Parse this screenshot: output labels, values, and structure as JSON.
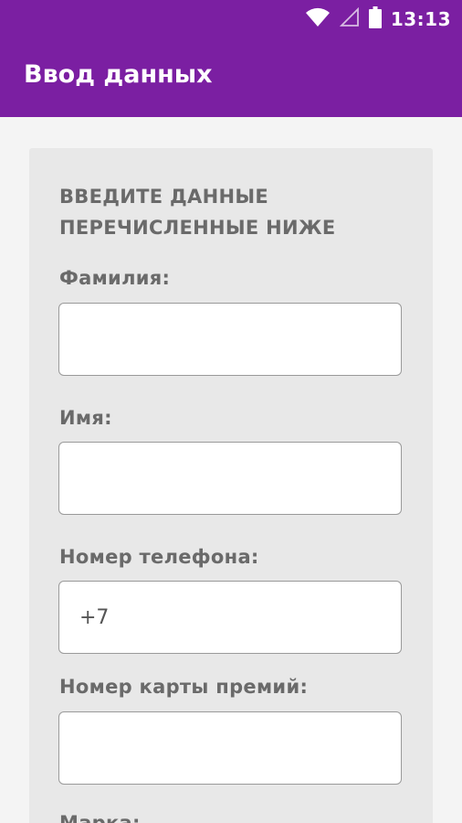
{
  "status_bar": {
    "time": "13:13",
    "icons": [
      "wifi-icon",
      "signal-icon",
      "battery-icon"
    ]
  },
  "app_bar": {
    "title": "Ввод данных",
    "color": "#7b1fa2"
  },
  "form": {
    "heading": "ВВЕДИТЕ ДАННЫЕ ПЕРЕЧИСЛЕННЫЕ НИЖЕ",
    "fields": [
      {
        "label": "Фамилия:",
        "value": ""
      },
      {
        "label": "Имя:",
        "value": ""
      },
      {
        "label": "Номер телефона:",
        "value": "+7"
      },
      {
        "label": "Номер карты премий:",
        "value": ""
      },
      {
        "label": "Марка:",
        "value": ""
      }
    ]
  }
}
